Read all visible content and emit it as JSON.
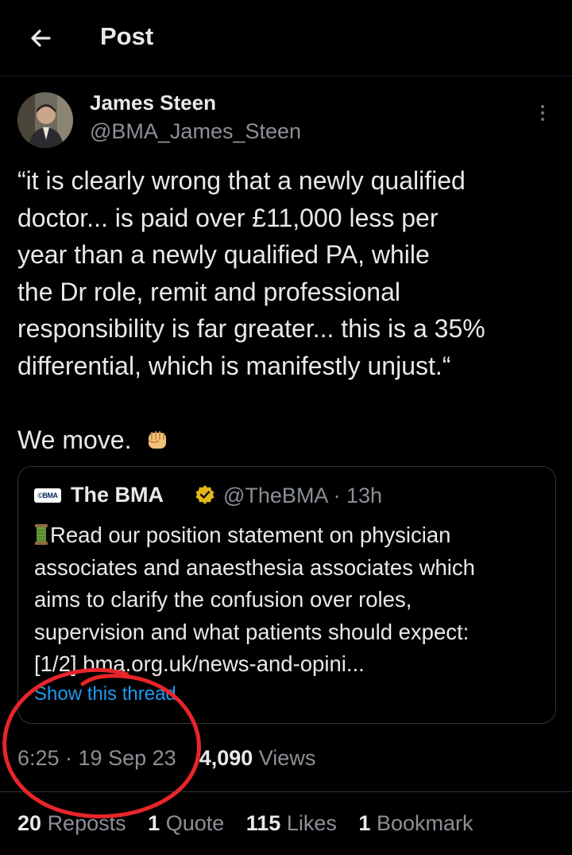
{
  "header": {
    "title": "Post",
    "back_icon": "arrow-left-icon"
  },
  "author": {
    "name": "James Steen",
    "handle": "@BMA_James_Steen"
  },
  "post": {
    "lines": [
      "“it is clearly wrong that a newly qualified",
      "doctor... is paid over £11,000 less per",
      "year than a newly qualified PA, while",
      "the Dr role, remit and professional",
      "responsibility is far greater... this is a 35%",
      "differential, which is manifestly unjust.“"
    ],
    "move": "We move.",
    "emoji": "raised-fist-icon"
  },
  "quoted": {
    "logo": "©BMA",
    "name": "The BMA",
    "handle": "@TheBMA · 13h",
    "lines": [
      "Read our position statement on physician",
      "associates and anaesthesia associates which",
      "aims to clarify the confusion over roles,",
      "supervision and what patients should expect:",
      "[1/2] bma.org.uk/news-and-opini..."
    ],
    "show_thread": "Show this thread"
  },
  "meta": {
    "time": "6:25 · 19 Sep 23",
    "views_count": "4,090",
    "views_label": "Views"
  },
  "stats": [
    {
      "count": "20",
      "label": "Reposts"
    },
    {
      "count": "1",
      "label": "Quote"
    },
    {
      "count": "115",
      "label": "Likes"
    },
    {
      "count": "1",
      "label": "Bookmark"
    }
  ],
  "colors": {
    "background": "#000000",
    "text": "#e7e9ea",
    "muted": "#8b9096",
    "link": "#1d9bf0",
    "annotation": "#e8252a"
  }
}
